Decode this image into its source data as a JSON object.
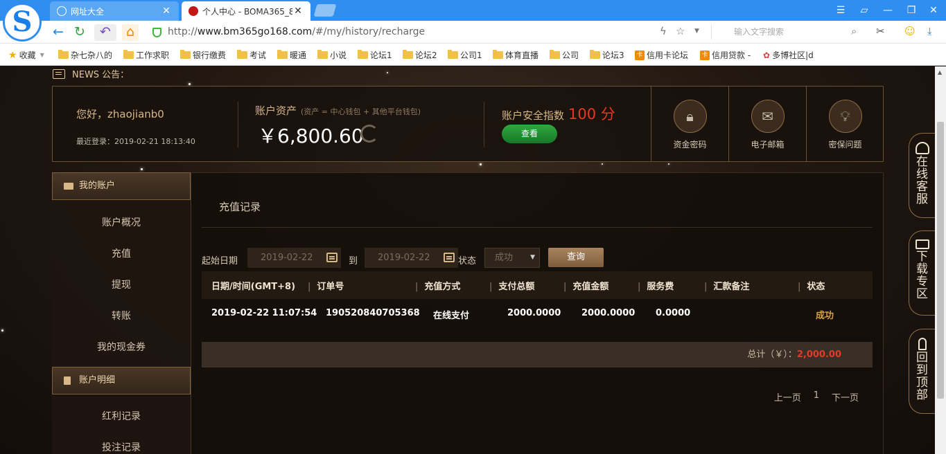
{
  "browser": {
    "tabs": [
      {
        "title": "网址大全"
      },
      {
        "title": "个人中心 - BOMA365_8"
      }
    ],
    "url_prefix": "http://",
    "url_host": "www.bm365go168.com",
    "url_path": "/#/my/history/recharge",
    "search_placeholder": "输入文字搜索",
    "bookmarks": [
      "收藏",
      "杂七杂八的",
      "工作求职",
      "银行缴费",
      "考试",
      "暖通",
      "小说",
      "论坛1",
      "论坛2",
      "公司1",
      "体育直播",
      "公司",
      "论坛3",
      "信用卡论坛",
      "信用贷款 -",
      "多博社区|d"
    ]
  },
  "news": {
    "label": "NEWS 公告："
  },
  "account": {
    "greeting": "您好，zhaojianb0",
    "last_login": "最近登录：2019-02-21 18:13:40",
    "asset_label": "账户资产",
    "asset_note": "(资产 = 中心钱包 + 其他平台钱包)",
    "balance": "￥6,800.60",
    "security_label": "账户安全指数",
    "security_score": "100 分",
    "view_button": "查看",
    "quick": [
      {
        "label": "资金密码",
        "icon": "lock-icon"
      },
      {
        "label": "电子邮箱",
        "icon": "mail-icon"
      },
      {
        "label": "密保问题",
        "icon": "bulb-icon"
      }
    ]
  },
  "sidebar": {
    "section1": "我的账户",
    "items1": [
      "账户概况",
      "充值",
      "提现",
      "转账",
      "我的现金券"
    ],
    "section2": "账户明细",
    "items2": [
      "红利记录",
      "投注记录"
    ]
  },
  "main": {
    "title": "充值记录",
    "filter": {
      "start_label": "起始日期",
      "start_value": "2019-02-22",
      "to_label": "到",
      "end_value": "2019-02-22",
      "status_label": "状态",
      "status_value": "成功",
      "query_button": "查询"
    },
    "columns": [
      "日期/时间(GMT+8)",
      "订单号",
      "充值方式",
      "支付总额",
      "充值金额",
      "服务费",
      "汇款备注",
      "状态"
    ],
    "rows": [
      [
        "2019-02-22 11:07:54",
        "190520840705368",
        "在线支付",
        "2000.0000",
        "2000.0000",
        "0.0000",
        "",
        "成功"
      ]
    ],
    "total_label": "总计（￥）：",
    "total_value": "2,000.00",
    "pager": {
      "prev": "上一页",
      "page": "1",
      "next": "下一页"
    }
  },
  "floats": [
    "在线客服",
    "下载专区",
    "回到顶部"
  ]
}
